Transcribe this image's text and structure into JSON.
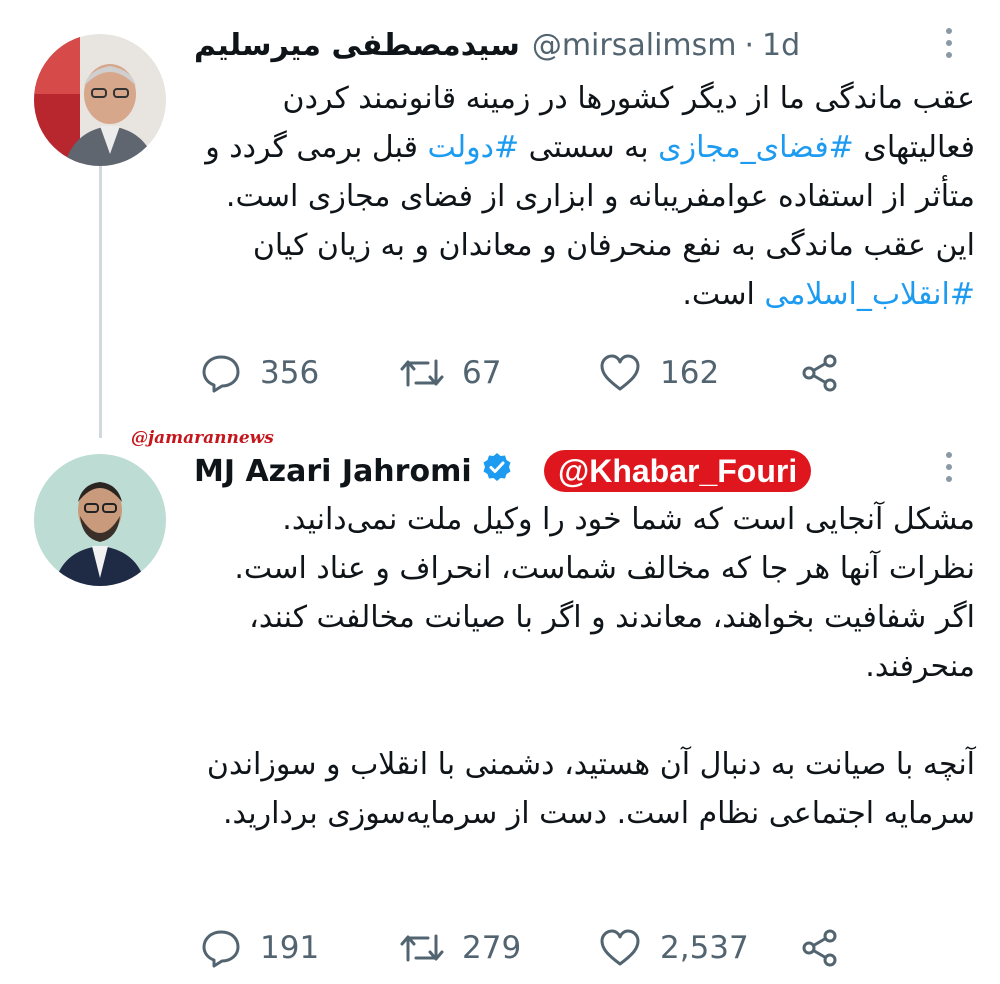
{
  "tweet1": {
    "name": "سیدمصطفی میرسلیم",
    "handle": "@mirsalimsm",
    "separator": "·",
    "time": "1d",
    "text_before_1": "عقب ماندگی ما از دیگر کشورها در زمینه قانونمند کردن فعالیتهای ",
    "hashtag_1": "#فضای_مجازی",
    "text_before_2": " به سستی ",
    "hashtag_2": "#دولت",
    "text_before_3": " قبل برمی گردد و متأثر از استفاده عوامفریبانه و ابزاری از فضای مجازی است. این عقب ماندگی به نفع منحرفان و معاندان و به زیان کیان ",
    "hashtag_3": "#انقلاب_اسلامی",
    "text_after_3": " است.",
    "replies": "356",
    "retweets": "67",
    "likes": "162"
  },
  "watermark": "@jamarannews",
  "tweet2": {
    "name": "MJ Azari Jahromi",
    "overlay_handle": "@Khabar_Fouri",
    "paragraph_1": "مشکل آنجایی است که شما خود را وکیل ملت نمی‌دانید. نظرات آنها هر جا که مخالف شماست، انحراف و عناد است. اگر شفافیت بخواهند، معاندند و اگر با صیانت مخالفت کنند، منحرفند.",
    "paragraph_2": "آنچه با صیانت به دنبال آن هستید، دشمنی با انقلاب و سوزاندن سرمایه اجتماعی نظام است. دست از سرمایه‌سوزی بردارید.",
    "replies": "191",
    "retweets": "279",
    "likes": "2,537"
  },
  "icons": {
    "reply": "reply-icon",
    "retweet": "retweet-icon",
    "like": "heart-icon",
    "share": "share-icon",
    "verified": "verified-badge-icon",
    "more": "more-options-icon"
  },
  "colors": {
    "hashtag": "#1d9bf0",
    "muted": "#536471",
    "verified": "#1d9bf0",
    "overlay_bg": "#e0161e",
    "watermark": "#c4161c"
  }
}
